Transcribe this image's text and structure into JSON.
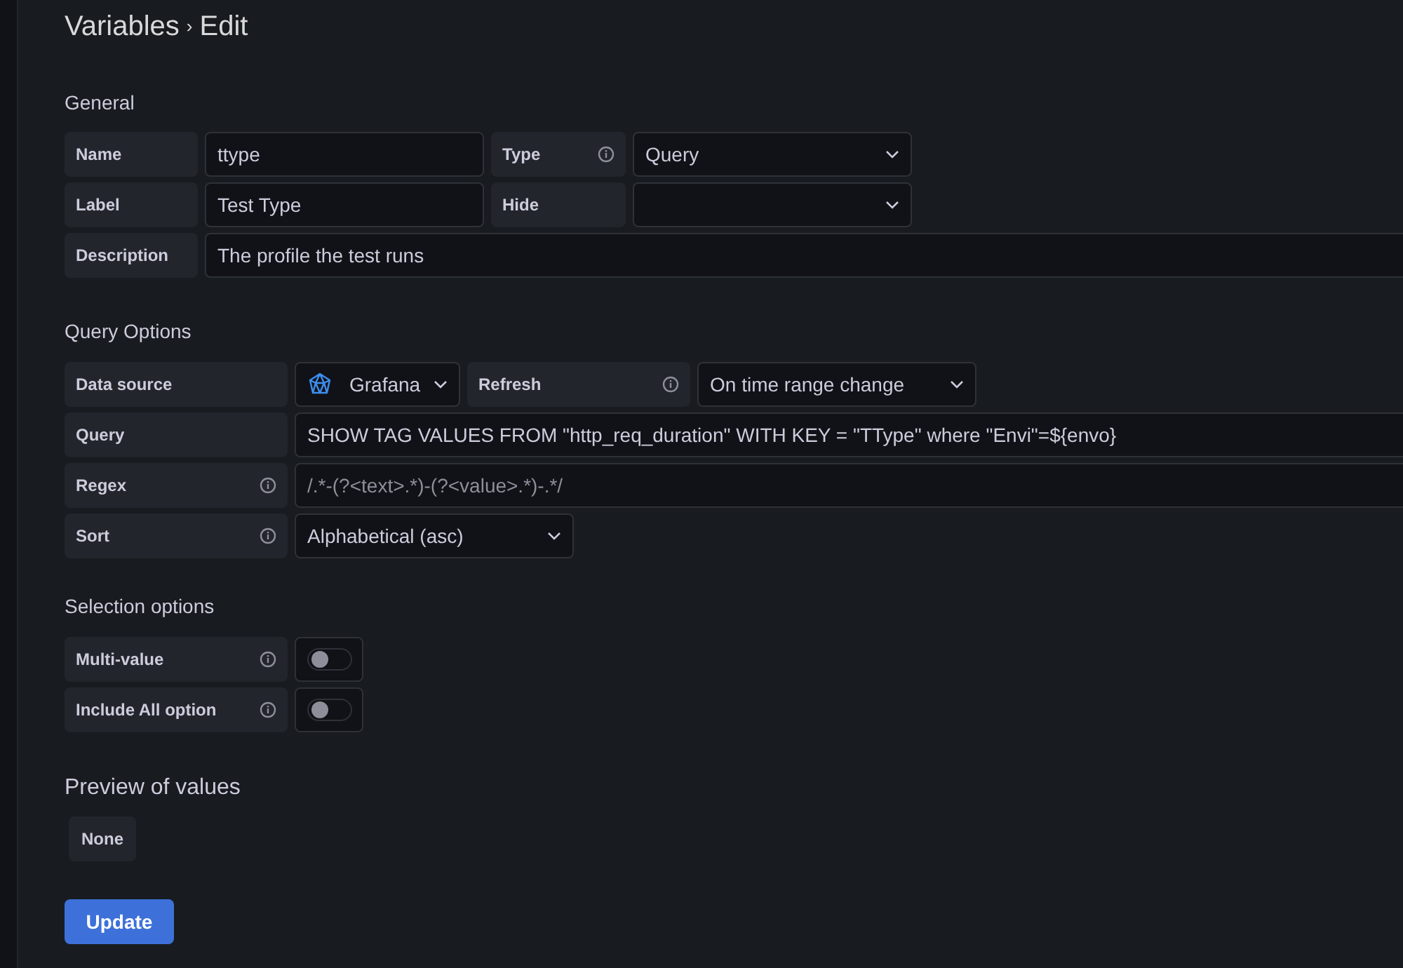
{
  "title": {
    "parent": "Variables",
    "separator": "›",
    "current": "Edit"
  },
  "general": {
    "heading": "General",
    "name": {
      "label": "Name",
      "value": "ttype"
    },
    "type": {
      "label": "Type",
      "value": "Query"
    },
    "label": {
      "label": "Label",
      "value": "Test Type"
    },
    "hide": {
      "label": "Hide"
    },
    "description": {
      "label": "Description",
      "value": "The profile the test runs"
    }
  },
  "query_options": {
    "heading": "Query Options",
    "data_source": {
      "label": "Data source",
      "value": "Grafana"
    },
    "refresh": {
      "label": "Refresh",
      "value": "On time range change"
    },
    "query": {
      "label": "Query",
      "value": "SHOW TAG VALUES FROM \"http_req_duration\" WITH KEY = \"TType\" where \"Envi\"=${envo}"
    },
    "regex": {
      "label": "Regex",
      "placeholder": "/.*-(?<text>.*)-(?<value>.*)-.*/"
    },
    "sort": {
      "label": "Sort",
      "value": "Alphabetical (asc)"
    }
  },
  "selection_options": {
    "heading": "Selection options",
    "toggles": [
      {
        "label": "Multi-value",
        "checked": false
      },
      {
        "label": "Include All option",
        "checked": false
      }
    ]
  },
  "preview": {
    "heading": "Preview of values",
    "values": [
      "None"
    ]
  },
  "update_button": "Update"
}
